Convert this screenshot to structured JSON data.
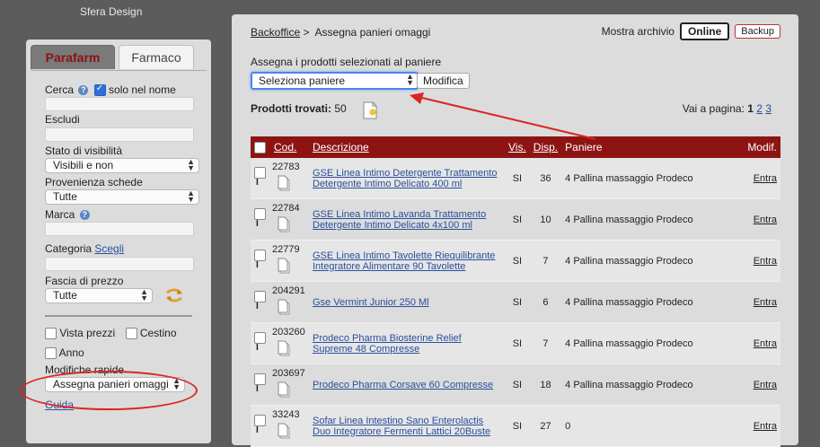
{
  "brand": "Sfera Design",
  "sidebar": {
    "tabs": [
      "Parafarm",
      "Farmaco"
    ],
    "cerca_label": "Cerca",
    "solo_nome_label": "solo nel nome",
    "escludi_label": "Escludi",
    "stato_label": "Stato di visibilità",
    "stato_value": "Visibili e non",
    "provenienza_label": "Provenienza schede",
    "provenienza_value": "Tutte",
    "marca_label": "Marca",
    "categoria_label": "Categoria",
    "scegli_link": "Scegli",
    "fascia_label": "Fascia di prezzo",
    "fascia_value": "Tutte",
    "vista_prezzi_label": "Vista prezzi",
    "cestino_label": "Cestino",
    "anno_label": "Anno",
    "modifiche_label": "Modifiche rapide",
    "modifiche_value": "Assegna panieri omaggi",
    "guida_link": "Guida"
  },
  "main": {
    "breadcrumb_root": "Backoffice",
    "breadcrumb_sep": ">",
    "breadcrumb_current": "Assegna panieri omaggi",
    "mostra_archivio": "Mostra archivio",
    "online_button": "Online",
    "backup_button": "Backup",
    "assign_label": "Assegna i prodotti selezionati al paniere",
    "assign_select_value": "Seleziona paniere",
    "modifica_button": "Modifica",
    "found_label": "Prodotti trovati:",
    "found_count": "50",
    "pager_label": "Vai a pagina:",
    "pages": [
      "1",
      "2",
      "3"
    ],
    "columns": [
      "Cod.",
      "Descrizione",
      "Vis.",
      "Disp.",
      "Paniere",
      "Modif."
    ],
    "rows": [
      {
        "cod": "22783",
        "desc": "GSE Linea Intimo Detergente Trattamento Detergente Intimo Delicato 400 ml",
        "vis": "SI",
        "disp": "36",
        "paniere": "4 Pallina massaggio Prodeco",
        "action": "Entra"
      },
      {
        "cod": "22784",
        "desc": "GSE Linea Intimo Lavanda Trattamento Detergente Intimo Delicato 4x100 ml",
        "vis": "SI",
        "disp": "10",
        "paniere": "4 Pallina massaggio Prodeco",
        "action": "Entra"
      },
      {
        "cod": "22779",
        "desc": "GSE Linea Intimo Tavolette Riequilibrante Integratore Alimentare 90 Tavolette",
        "vis": "SI",
        "disp": "7",
        "paniere": "4 Pallina massaggio Prodeco",
        "action": "Entra"
      },
      {
        "cod": "204291",
        "desc": "Gse Vermint Junior 250 Ml",
        "vis": "SI",
        "disp": "6",
        "paniere": "4 Pallina massaggio Prodeco",
        "action": "Entra"
      },
      {
        "cod": "203260",
        "desc": "Prodeco Pharma Biosterine Relief Supreme 48 Compresse",
        "vis": "SI",
        "disp": "7",
        "paniere": "4 Pallina massaggio Prodeco",
        "action": "Entra"
      },
      {
        "cod": "203697",
        "desc": "Prodeco Pharma Corsave 60 Compresse",
        "vis": "SI",
        "disp": "18",
        "paniere": "4 Pallina massaggio Prodeco",
        "action": "Entra"
      },
      {
        "cod": "33243",
        "desc": "Sofar Linea Intestino Sano Enterolactis Duo Integratore Fermenti Lattici 20Buste",
        "vis": "SI",
        "disp": "27",
        "paniere": "0",
        "action": "Entra"
      }
    ]
  },
  "colors": {
    "header_red": "#8e1414",
    "annotation_red": "#d92525",
    "focus_blue": "#4a86e8"
  }
}
